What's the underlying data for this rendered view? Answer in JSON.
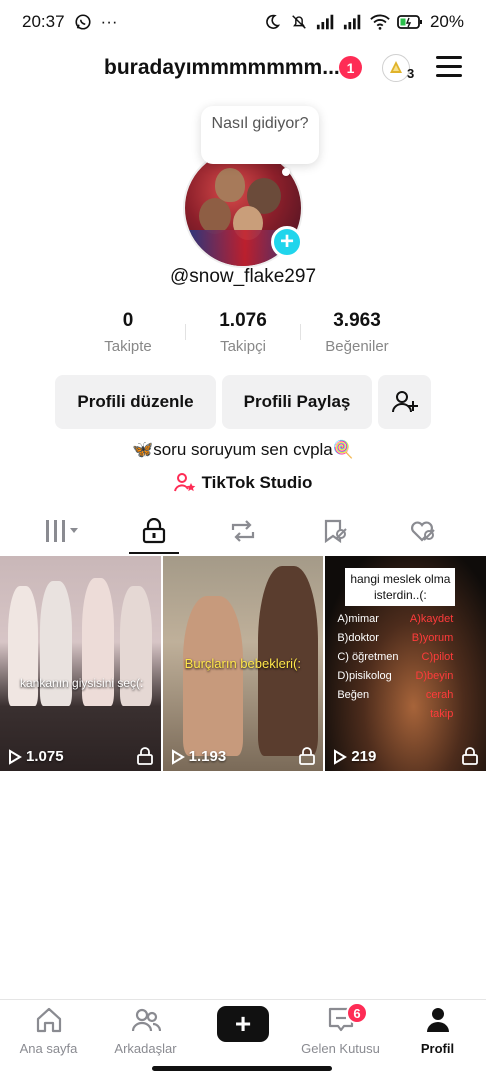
{
  "status_bar": {
    "time": "20:37",
    "extra": "···",
    "battery": "20%"
  },
  "header": {
    "username": "buradayımmmmmmm...",
    "notification_count": "1",
    "coin_count": "3"
  },
  "bubble": {
    "text": "Nasıl gidiyor?"
  },
  "profile": {
    "handle": "@snow_flake297"
  },
  "stats": [
    {
      "value": "0",
      "label": "Takipte"
    },
    {
      "value": "1.076",
      "label": "Takipçi"
    },
    {
      "value": "3.963",
      "label": "Beğeniler"
    }
  ],
  "buttons": {
    "edit": "Profili düzenle",
    "share": "Profili Paylaş"
  },
  "bio": "🦋soru soruyum sen cvpla🍭",
  "studio": "TikTok Studio",
  "videos": [
    {
      "views": "1.075",
      "caption": "kankanın giysisini seç(:"
    },
    {
      "views": "1.193",
      "caption": "Burçların bebekleri(:"
    },
    {
      "views": "219",
      "caption": "hangi meslek olma isterdin..(:"
    }
  ],
  "video3_options": {
    "left": [
      "A)mimar",
      "B)doktor",
      "C) öğretmen",
      "D)pisikolog"
    ],
    "left_extra": "Beğen",
    "right": [
      "A)kaydet",
      "B)yorum",
      "C)pilot",
      "D)beyin cerah",
      "takip"
    ]
  },
  "bottom_nav": {
    "home": "Ana sayfa",
    "friends": "Arkadaşlar",
    "inbox": "Gelen Kutusu",
    "inbox_badge": "6",
    "profile": "Profil"
  },
  "colors": {
    "accent_red": "#fe2c55",
    "accent_cyan": "#25f4ee",
    "plus_blue": "#20d5ec"
  }
}
